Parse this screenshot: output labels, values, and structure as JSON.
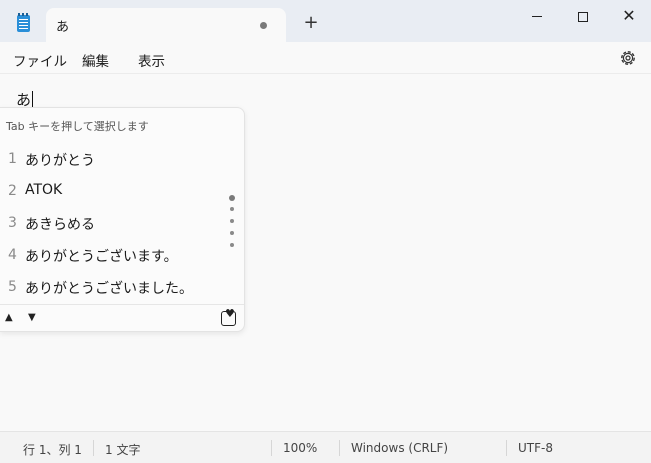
{
  "tab": {
    "title": "あ"
  },
  "menu": {
    "file": "ファイル",
    "edit": "編集",
    "view": "表示"
  },
  "editor": {
    "text": "あ"
  },
  "ime": {
    "hint": "Tab キーを押して選択します",
    "candidates": [
      {
        "num": "1",
        "text": "ありがとう"
      },
      {
        "num": "2",
        "text": "ATOK"
      },
      {
        "num": "3",
        "text": "あきらめる"
      },
      {
        "num": "4",
        "text": "ありがとうございます。"
      },
      {
        "num": "5",
        "text": "ありがとうございました。"
      }
    ],
    "page_count": 5,
    "active_page": 1
  },
  "status": {
    "position": "行 1、列 1",
    "chars": "1 文字",
    "zoom": "100%",
    "line_ending": "Windows (CRLF)",
    "encoding": "UTF-8"
  },
  "icons": {
    "app": "notepad-icon",
    "tab_dirty": "unsaved-dot-icon",
    "new_tab": "plus-icon",
    "settings": "gear-icon",
    "ime_up": "triangle-up-icon",
    "ime_down": "triangle-down-icon",
    "ime_menu": "heart-menu-icon"
  },
  "colors": {
    "accent": "#2a8fd8",
    "titlebar": "#e9edf3",
    "background": "#f9f9f9"
  }
}
